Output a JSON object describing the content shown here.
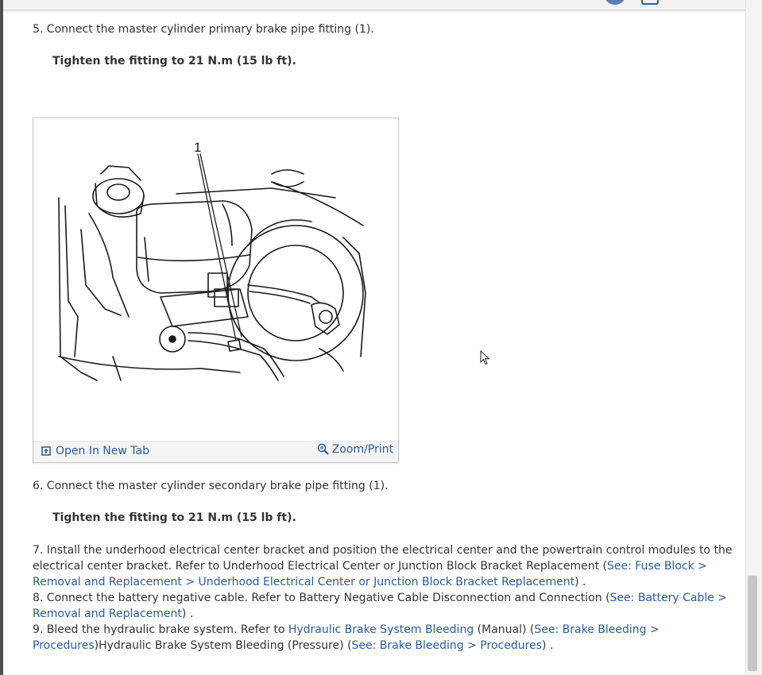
{
  "steps": {
    "s5": {
      "text": "5. Connect the master cylinder primary brake pipe fitting (1).",
      "torque": "Tighten the fitting to 21 N.m (15 lb ft)."
    },
    "figure": {
      "callout": "1",
      "open_tab": "Open In New Tab",
      "zoom": "Zoom/Print"
    },
    "s6": {
      "text": "6. Connect the master cylinder secondary brake pipe fitting (1).",
      "torque": "Tighten the fitting to 21 N.m (15 lb ft)."
    },
    "s7": {
      "text": "7. Install the underhood electrical center bracket and position the electrical center and the powertrain control modules to the electrical center bracket. Refer to Underhood Electrical Center or Junction Block Bracket Replacement (",
      "link": "See: Fuse Block > Removal and Replacement > Underhood Electrical Center or Junction Block Bracket Replacement",
      "tail": ") ."
    },
    "s8": {
      "text": "8. Connect the battery negative cable. Refer to Battery Negative Cable Disconnection and Connection (",
      "link": "See: Battery Cable > Removal and Replacement",
      "tail": ") ."
    },
    "s9": {
      "text": "9. Bleed the hydraulic brake system. Refer to ",
      "link1": "Hydraulic Brake System Bleeding",
      "mid1": " (Manual) (",
      "link2": "See: Brake Bleeding > Procedures",
      "mid2": ")Hydraulic Brake System Bleeding (Pressure) (",
      "link3": "See: Brake Bleeding > Procedures",
      "tail": ") ."
    }
  }
}
